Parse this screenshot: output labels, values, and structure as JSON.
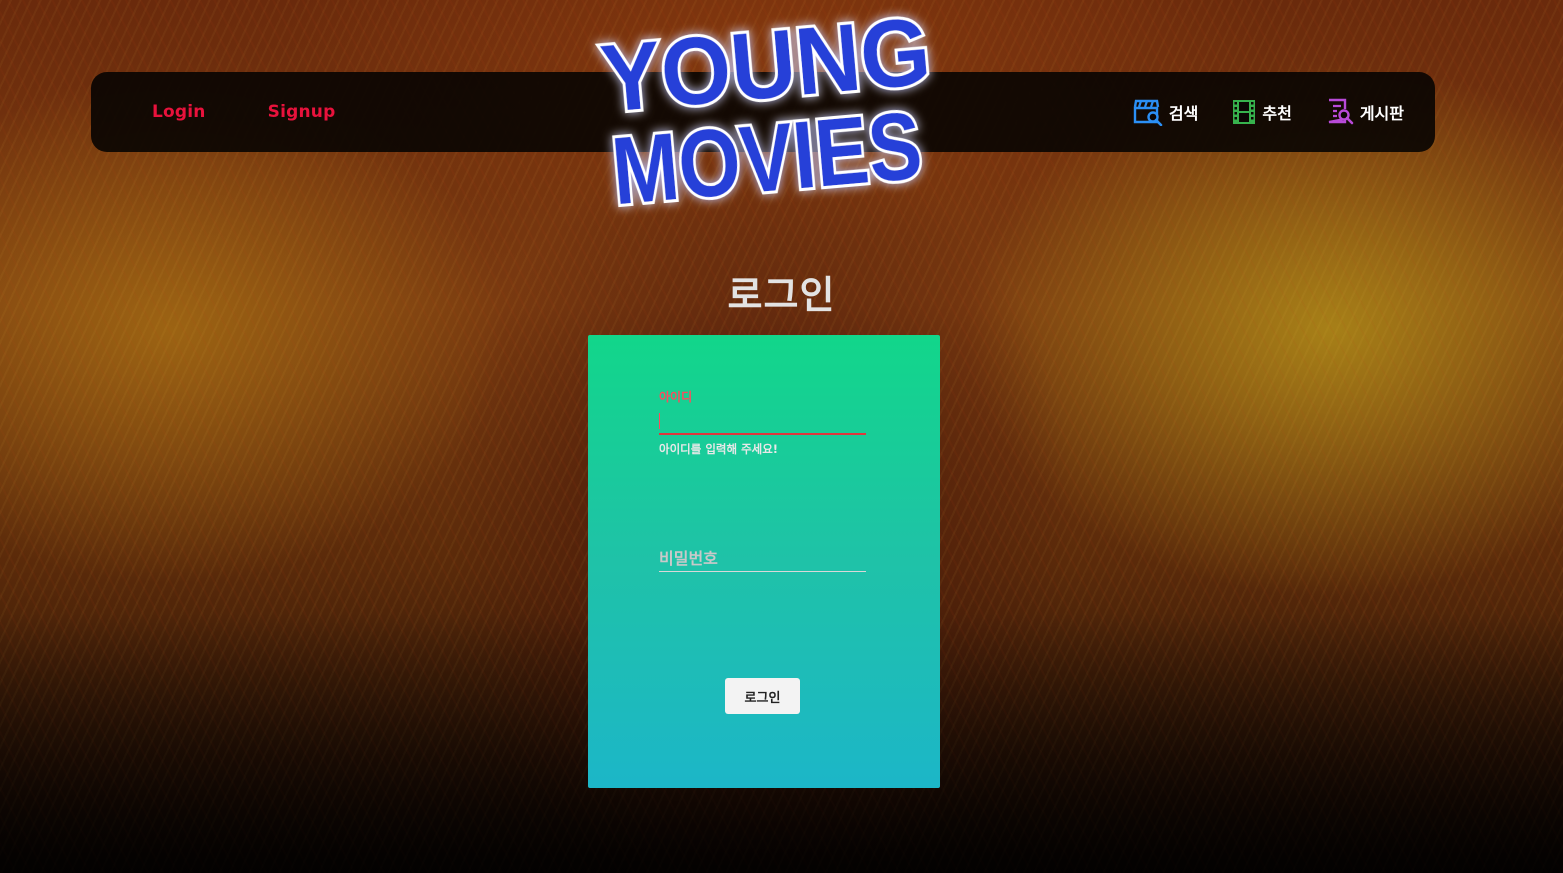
{
  "brand": {
    "line1": "YOUNG",
    "line2": "MOVIES",
    "color": "#2540d8",
    "glow": "#ffffff"
  },
  "nav": {
    "left": [
      {
        "label": "Login"
      },
      {
        "label": "Signup"
      }
    ],
    "right": [
      {
        "label": "검색",
        "icon": "clapper-search-icon",
        "color": "#2b8ff5"
      },
      {
        "label": "추천",
        "icon": "film-strip-icon",
        "color": "#37b24d"
      },
      {
        "label": "게시판",
        "icon": "document-search-icon",
        "color": "#b84ad8"
      }
    ],
    "link_color": "#e8123c"
  },
  "page": {
    "title": "로그인"
  },
  "form": {
    "id_label": "아이디",
    "id_value": "",
    "id_error": "아이디를 입력해 주세요!",
    "password_placeholder": "비밀번호",
    "submit_label": "로그인",
    "border_colors": [
      "#12d68a",
      "#1cb6c8"
    ],
    "error_color": "#ff4a5c"
  }
}
